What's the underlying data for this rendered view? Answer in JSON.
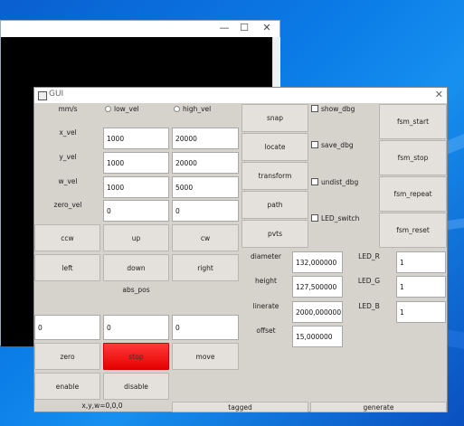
{
  "back_window": {
    "min_glyph": "—",
    "max_glyph": "☐",
    "close_glyph": "✕"
  },
  "gui": {
    "title": "GUI",
    "close_glyph": "✕",
    "units_label": "mm/s",
    "low_vel_label": "low_vel",
    "high_vel_label": "high_vel",
    "x_vel_label": "x_vel",
    "y_vel_label": "y_vel",
    "w_vel_label": "w_vel",
    "zero_vel_label": "zero_vel",
    "x_vel_low": "1000",
    "x_vel_high": "20000",
    "y_vel_low": "1000",
    "y_vel_high": "20000",
    "w_vel_low": "1000",
    "w_vel_high": "5000",
    "zero_vel_low": "0",
    "zero_vel_high": "0",
    "ccw": "ccw",
    "up": "up",
    "cw": "cw",
    "left": "left",
    "down": "down",
    "right": "right",
    "abs_pos_label": "abs_pos",
    "abs_pos_x": "0",
    "abs_pos_y": "0",
    "abs_pos_w": "0",
    "zero": "zero",
    "stop": "stop",
    "move": "move",
    "enable": "enable",
    "disable": "disable",
    "status": "x,y,w=0,0,0",
    "snap": "snap",
    "locate": "locate",
    "transform": "transform",
    "path": "path",
    "pvts": "pvts",
    "show_dbg": "show_dbg",
    "save_dbg": "save_dbg",
    "undist_dbg": "undist_dbg",
    "led_switch": "LED_switch",
    "fsm_start": "fsm_start",
    "fsm_stop": "fsm_stop",
    "fsm_repeat": "fsm_repeat",
    "fsm_reset": "fsm_reset",
    "diameter_label": "diameter",
    "diameter": "132,000000",
    "height_label": "height",
    "height": "127,500000",
    "linerate_label": "linerate",
    "linerate": "2000,000000",
    "offset_label": "offset",
    "offset": "15,000000",
    "led_r_label": "LED_R",
    "led_r": "1",
    "led_g_label": "LED_G",
    "led_g": "1",
    "led_b_label": "LED_B",
    "led_b": "1",
    "tagged": "tagged",
    "generate": "generate"
  }
}
